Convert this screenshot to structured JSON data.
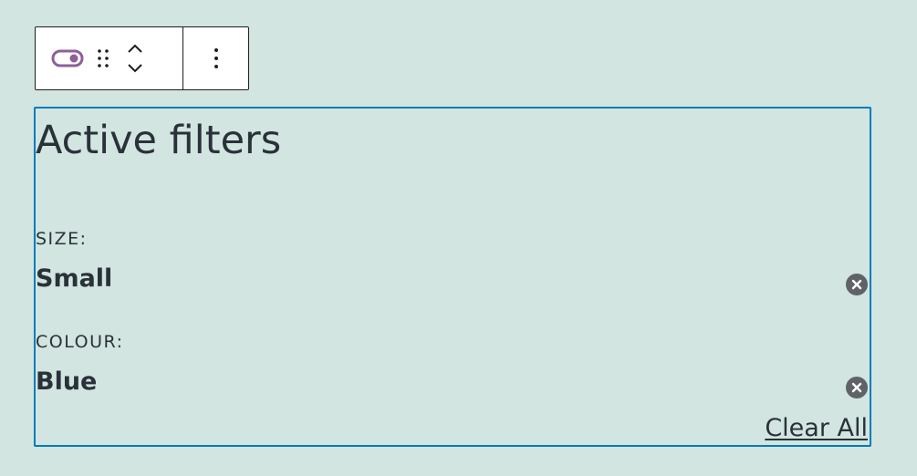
{
  "toolbar": {
    "buttons": [
      {
        "name": "block-type",
        "icon": "toggle-icon"
      },
      {
        "name": "drag",
        "icon": "drag-dots-icon"
      },
      {
        "name": "move-up",
        "icon": "chevron-up-icon"
      },
      {
        "name": "move-down",
        "icon": "chevron-down-icon"
      },
      {
        "name": "options",
        "icon": "more-vertical-icon"
      }
    ],
    "accent_color": "#8f5f98"
  },
  "block": {
    "title": "Active filters",
    "border_color": "#007cba",
    "filters": [
      {
        "label": "SIZE:",
        "value": "Small",
        "remove_icon": "close-circle-icon"
      },
      {
        "label": "COLOUR:",
        "value": "Blue",
        "remove_icon": "close-circle-icon"
      }
    ],
    "clear_all_label": "Clear All"
  },
  "colors": {
    "background": "#d2e5e0",
    "text": "#2a313a",
    "remove_icon": "#5f6368"
  }
}
